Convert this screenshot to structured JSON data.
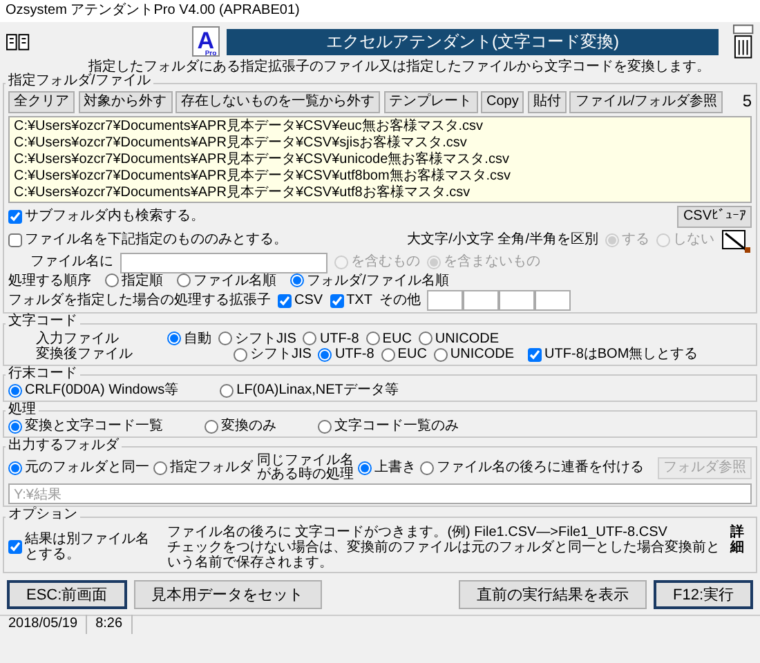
{
  "window": {
    "title": "Ozsystem アテンダントPro V4.00 (APRABE01)"
  },
  "header": {
    "logo_letter": "A",
    "logo_sub": "Pro",
    "banner": "エクセルアテンダント(文字コード変換)",
    "description": "指定したフォルダにある指定拡張子のファイル又は指定したファイルから文字コードを変換します。"
  },
  "files_group": {
    "title": "指定フォルダ/ファイル",
    "buttons": [
      "全クリア",
      "対象から外す",
      "存在しないものを一覧から外す",
      "テンプレート",
      "Copy",
      "貼付",
      "ファイル/フォルダ参照"
    ],
    "count": "5",
    "files": [
      "C:¥Users¥ozcr7¥Documents¥APR見本データ¥CSV¥euc無お客様マスタ.csv",
      "C:¥Users¥ozcr7¥Documents¥APR見本データ¥CSV¥sjisお客様マスタ.csv",
      "C:¥Users¥ozcr7¥Documents¥APR見本データ¥CSV¥unicode無お客様マスタ.csv",
      "C:¥Users¥ozcr7¥Documents¥APR見本データ¥CSV¥utf8bom無お客様マスタ.csv",
      "C:¥Users¥ozcr7¥Documents¥APR見本データ¥CSV¥utf8お客様マスタ.csv"
    ]
  },
  "search": {
    "subfolder": {
      "label": "サブフォルダ内も検索する。",
      "checked": true
    },
    "filename_only": {
      "label": "ファイル名を下記指定のもののみとする。",
      "checked": false
    },
    "csv_viewer": "CSVﾋﾞｭｰｱ",
    "case_label": "大文字/小文字 全角/半角を区別",
    "case_options": [
      {
        "label": "する",
        "selected": true,
        "disabled": true
      },
      {
        "label": "しない",
        "selected": false,
        "disabled": true
      }
    ],
    "filename_label": "ファイル名に",
    "include_options": [
      {
        "label": "を含むもの",
        "selected": false,
        "disabled": true
      },
      {
        "label": "を含まないもの",
        "selected": true,
        "disabled": true
      }
    ],
    "order_label": "処理する順序",
    "order_options": [
      {
        "label": "指定順",
        "selected": false
      },
      {
        "label": "ファイル名順",
        "selected": false
      },
      {
        "label": "フォルダ/ファイル名順",
        "selected": true
      }
    ],
    "ext_label": "フォルダを指定した場合の処理する拡張子",
    "extensions": [
      {
        "label": "CSV",
        "checked": true
      },
      {
        "label": "TXT",
        "checked": true
      }
    ],
    "other_label": "その他"
  },
  "char_code": {
    "title": "文字コード",
    "input": {
      "label": "入力ファイル",
      "options": [
        {
          "label": "自動",
          "selected": true
        },
        {
          "label": "シフトJIS",
          "selected": false
        },
        {
          "label": "UTF-8",
          "selected": false
        },
        {
          "label": "EUC",
          "selected": false
        },
        {
          "label": "UNICODE",
          "selected": false
        }
      ]
    },
    "output": {
      "label": "変換後ファイル",
      "options": [
        {
          "label": "シフトJIS",
          "selected": false
        },
        {
          "label": "UTF-8",
          "selected": true
        },
        {
          "label": "EUC",
          "selected": false
        },
        {
          "label": "UNICODE",
          "selected": false
        }
      ]
    },
    "bom": {
      "label": "UTF-8はBOM無しとする",
      "checked": true
    }
  },
  "line_end": {
    "title": "行末コード",
    "options": [
      {
        "label": "CRLF(0D0A) Windows等",
        "selected": true
      },
      {
        "label": "LF(0A)Linax,NETデータ等",
        "selected": false
      }
    ]
  },
  "process": {
    "title": "処理",
    "options": [
      {
        "label": "変換と文字コード一覧",
        "selected": true
      },
      {
        "label": "変換のみ",
        "selected": false
      },
      {
        "label": "文字コード一覧のみ",
        "selected": false
      }
    ]
  },
  "output_folder": {
    "title": "出力するフォルダ",
    "options": [
      {
        "label": "元のフォルダと同一",
        "selected": true
      },
      {
        "label": "指定フォルダ",
        "selected": false
      }
    ],
    "same_name_label": [
      "同じファイル名",
      "がある時の処理"
    ],
    "same_name_options": [
      {
        "label": "上書き",
        "selected": true
      },
      {
        "label": "ファイル名の後ろに連番を付ける",
        "selected": false
      }
    ],
    "browse_button": {
      "label": "フォルダ参照",
      "disabled": true
    },
    "path": {
      "value": "Y:¥結果",
      "disabled": true
    }
  },
  "option_group": {
    "title": "オプション",
    "separate": {
      "label": "結果は別ファイル名とする。",
      "checked": true
    },
    "notes": [
      "ファイル名の後ろに 文字コードがつきます。(例) File1.CSV―>File1_UTF-8.CSV",
      "チェックをつけない場合は、変換前のファイルは元のフォルダと同一とした場合変換前という名前で保存されます。"
    ],
    "detail": "詳細"
  },
  "buttons": [
    {
      "label": "ESC:前画面",
      "default": true
    },
    {
      "label": "見本用データをセット",
      "default": false
    },
    {
      "label": "直前の実行結果を表示",
      "default": false
    },
    {
      "label": "F12:実行",
      "default": true
    }
  ],
  "status_bar": [
    "2018/05/19",
    "8:26"
  ]
}
